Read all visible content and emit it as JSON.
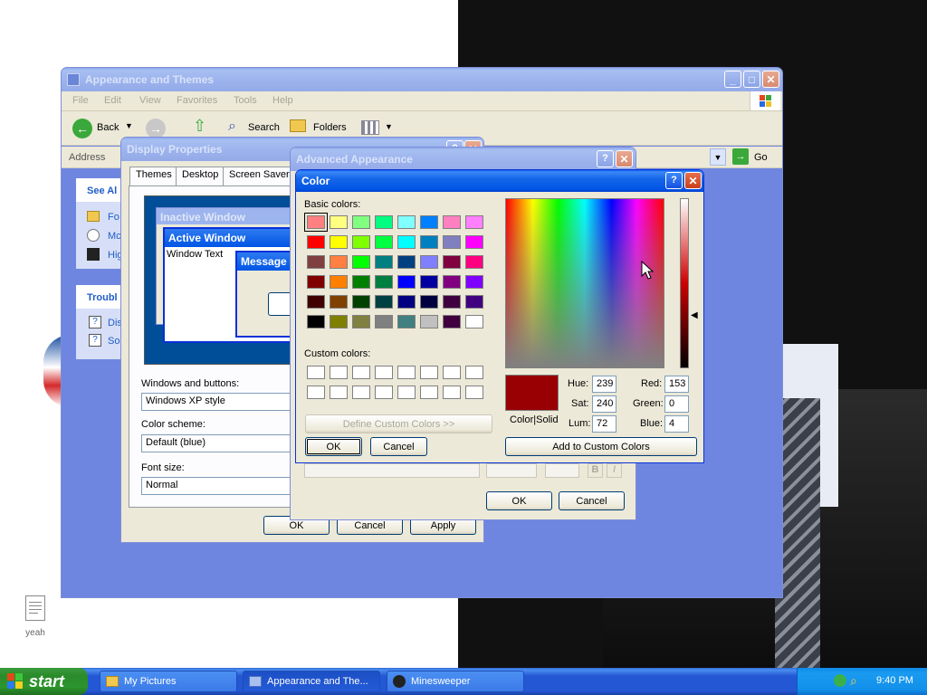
{
  "desktop": {
    "icon_label": "yeah"
  },
  "appearance_window": {
    "title": "Appearance and Themes",
    "menu": [
      "File",
      "Edit",
      "View",
      "Favorites",
      "Tools",
      "Help"
    ],
    "toolbar": {
      "back": "Back",
      "search": "Search",
      "folders": "Folders"
    },
    "address_label": "Address",
    "go_label": "Go",
    "sidebar": {
      "see_also_title": "See Al",
      "see_also_items": [
        "Fo",
        "Mc",
        "Hig"
      ],
      "trouble_title": "Troubl",
      "trouble_items": [
        "Dis",
        "So"
      ]
    }
  },
  "display_properties": {
    "title": "Display Properties",
    "tabs": [
      "Themes",
      "Desktop",
      "Screen Saver"
    ],
    "preview": {
      "inactive": "Inactive Window",
      "active": "Active Window",
      "window_text": "Window Text",
      "message": "Message"
    },
    "windows_buttons_label": "Windows and buttons:",
    "windows_buttons_value": "Windows XP style",
    "color_scheme_label": "Color scheme:",
    "color_scheme_value": "Default (blue)",
    "font_size_label": "Font size:",
    "font_size_value": "Normal",
    "ok": "OK",
    "cancel": "Cancel",
    "apply": "Apply"
  },
  "advanced_appearance": {
    "title": "Advanced Appearance",
    "ok": "OK",
    "cancel": "Cancel",
    "bold_label": "B",
    "italic_label": "I"
  },
  "color_dialog": {
    "title": "Color",
    "basic_colors_label": "Basic colors:",
    "custom_colors_label": "Custom colors:",
    "define_custom": "Define Custom Colors >>",
    "ok": "OK",
    "cancel": "Cancel",
    "color_solid": "Color|Solid",
    "add_custom": "Add to Custom Colors",
    "hue_label": "Hue:",
    "hue": "239",
    "sat_label": "Sat:",
    "sat": "240",
    "lum_label": "Lum:",
    "lum": "72",
    "red_label": "Red:",
    "red": "153",
    "green_label": "Green:",
    "green": "0",
    "blue_label": "Blue:",
    "blue": "4",
    "current_color": "#990004",
    "basic_colors": [
      [
        "#ff8080",
        "#ffff80",
        "#80ff80",
        "#00ff80",
        "#80ffff",
        "#0080ff",
        "#ff80c0",
        "#ff80ff"
      ],
      [
        "#ff0000",
        "#ffff00",
        "#80ff00",
        "#00ff40",
        "#00ffff",
        "#0080c0",
        "#8080c0",
        "#ff00ff"
      ],
      [
        "#804040",
        "#ff8040",
        "#00ff00",
        "#008080",
        "#004080",
        "#8080ff",
        "#800040",
        "#ff0080"
      ],
      [
        "#800000",
        "#ff8000",
        "#008000",
        "#008040",
        "#0000ff",
        "#0000a0",
        "#800080",
        "#8000ff"
      ],
      [
        "#400000",
        "#804000",
        "#004000",
        "#004040",
        "#000080",
        "#000040",
        "#400040",
        "#400080"
      ],
      [
        "#000000",
        "#808000",
        "#808040",
        "#808080",
        "#408080",
        "#c0c0c0",
        "#400040",
        "#ffffff"
      ]
    ]
  },
  "taskbar": {
    "start": "start",
    "tasks": [
      "My Pictures",
      "Appearance and The...",
      "Minesweeper"
    ],
    "clock": "9:40 PM"
  }
}
